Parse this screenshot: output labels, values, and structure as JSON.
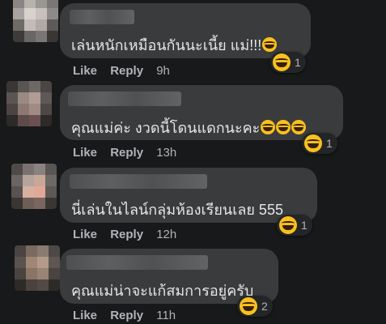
{
  "comments": [
    {
      "text": "เล่นหนักเหมือนกันนะเนี้ย แม่!!!",
      "inline_emojis": [
        "laughing-tears"
      ],
      "reaction_emoji": "grinning-squinting",
      "reaction_count": "1",
      "like_label": "Like",
      "reply_label": "Reply",
      "time": "9h"
    },
    {
      "text": "คุณแม่ค่ะ งวดนี้โดนแดกนะคะ",
      "inline_emojis": [
        "laughing-tears",
        "laughing-tears",
        "laughing-tears"
      ],
      "reaction_emoji": "grinning-squinting",
      "reaction_count": "1",
      "like_label": "Like",
      "reply_label": "Reply",
      "time": "13h"
    },
    {
      "text": "นี่เล่นในไลน์กลุ่มห้องเรียนเลย 555",
      "inline_emojis": [],
      "reaction_emoji": "grinning-squinting",
      "reaction_count": "1",
      "like_label": "Like",
      "reply_label": "Reply",
      "time": "12h"
    },
    {
      "text": "คุณแม่น่าจะแก้สมการอยู่ครับ",
      "inline_emojis": [],
      "reaction_emoji": "grinning-squinting",
      "reaction_count": "2",
      "like_label": "Like",
      "reply_label": "Reply",
      "time": "11h"
    }
  ],
  "colors": {
    "background": "#18191a",
    "bubble": "#3a3b3c",
    "text": "#e4e6eb",
    "secondary_text": "#b0b3b8",
    "emoji": "#f7c11e"
  }
}
